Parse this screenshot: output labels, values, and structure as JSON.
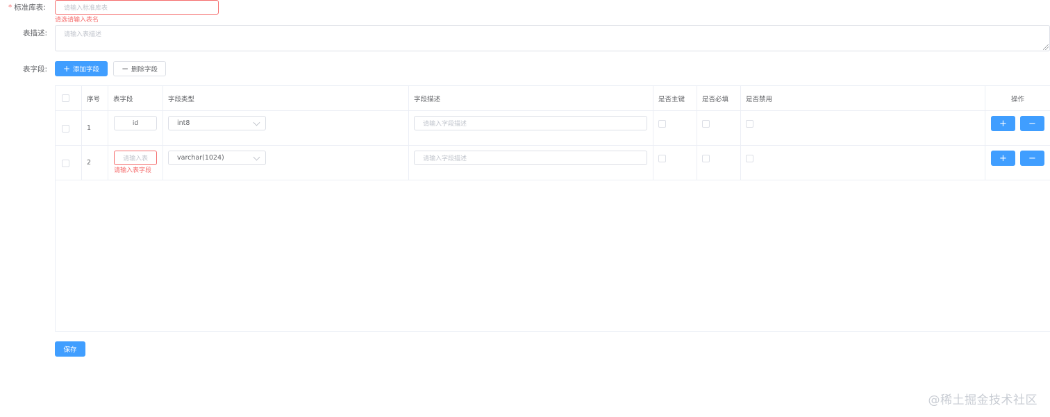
{
  "form": {
    "table_name": {
      "label": "标准库表:",
      "required_mark": "*",
      "placeholder": "请输入标准库表",
      "error": "请选请输入表名"
    },
    "table_desc": {
      "label": "表描述:",
      "placeholder": "请输入表描述"
    },
    "fields": {
      "label": "表字段:",
      "add_button": "添加字段",
      "add_icon": "+",
      "delete_button": "删除字段",
      "delete_icon": "−"
    }
  },
  "table": {
    "columns": [
      "序号",
      "表字段",
      "字段类型",
      "字段描述",
      "是否主键",
      "是否必填",
      "是否禁用",
      "操作"
    ],
    "rows": [
      {
        "index": "1",
        "field_value": "id",
        "field_placeholder": "",
        "field_error": "",
        "type": "int8",
        "desc_placeholder": "请输入字段描述"
      },
      {
        "index": "2",
        "field_value": "",
        "field_placeholder": "请输入表",
        "field_error": "请输入表字段",
        "type": "varchar(1024)",
        "desc_placeholder": "请输入字段描述"
      }
    ],
    "op_add_icon": "+",
    "op_remove_icon": "−"
  },
  "save_button": "保存",
  "watermark": "@稀土掘金技术社区",
  "colors": {
    "primary": "#409eff",
    "error": "#f56c6c",
    "border": "#dcdfe6",
    "table_border": "#ebeef5"
  }
}
